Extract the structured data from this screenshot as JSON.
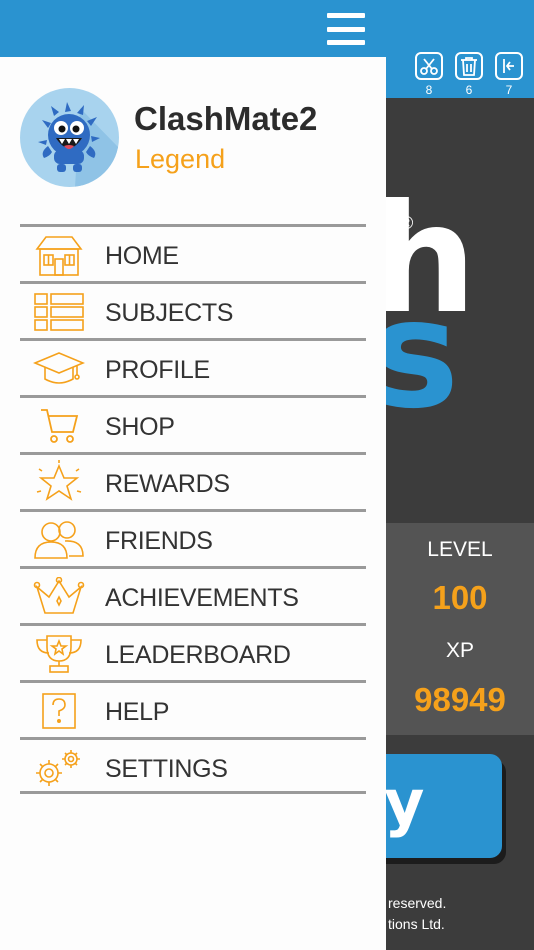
{
  "background": {
    "toolbar": [
      {
        "icon": "scissors-icon",
        "count": "8"
      },
      {
        "icon": "trash-icon",
        "count": "6"
      },
      {
        "icon": "arrow-left-box-icon",
        "count": "7"
      }
    ],
    "logo_part1": "h",
    "logo_part2": "s",
    "registered": "®",
    "level_label": "LEVEL",
    "level_value": "100",
    "xp_label": "XP",
    "xp_value": "98949",
    "button_letter": "y",
    "footer_line1": "reserved.",
    "footer_line2": "tions Ltd."
  },
  "drawer": {
    "menu_icon": "hamburger-menu-icon",
    "profile": {
      "avatar": "blue-monster-avatar",
      "username": "ClashMate2",
      "rank": "Legend"
    },
    "items": [
      {
        "label": "HOME",
        "icon": "house-icon"
      },
      {
        "label": "SUBJECTS",
        "icon": "list-icon"
      },
      {
        "label": "PROFILE",
        "icon": "graduation-cap-icon"
      },
      {
        "label": "SHOP",
        "icon": "cart-icon"
      },
      {
        "label": "REWARDS",
        "icon": "star-burst-icon"
      },
      {
        "label": "FRIENDS",
        "icon": "people-icon"
      },
      {
        "label": "ACHIEVEMENTS",
        "icon": "crown-icon"
      },
      {
        "label": "LEADERBOARD",
        "icon": "trophy-icon"
      },
      {
        "label": "HELP",
        "icon": "question-icon"
      },
      {
        "label": "SETTINGS",
        "icon": "gears-icon"
      }
    ]
  },
  "colors": {
    "blue": "#2a93d0",
    "orange": "#f5a11b",
    "dark": "#3c3c3c"
  }
}
